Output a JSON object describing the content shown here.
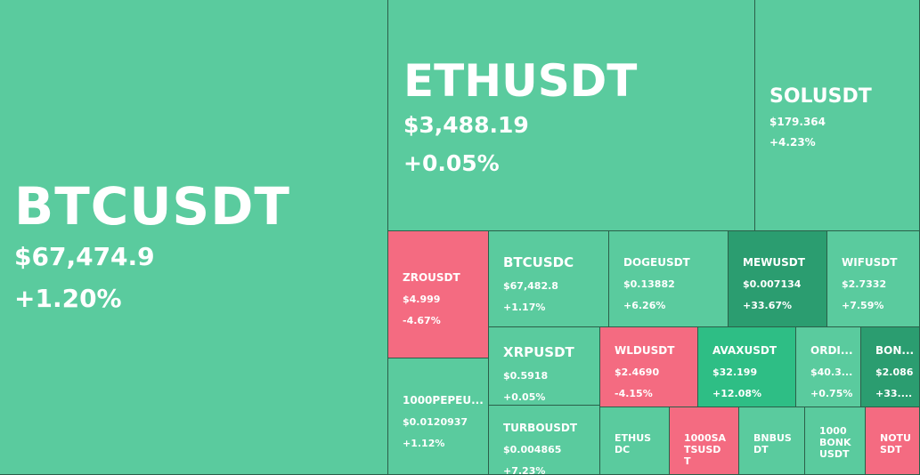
{
  "heatmap": {
    "tiles": {
      "btcusdt": {
        "symbol": "BTCUSDT",
        "price": "$67,474.9",
        "change": "+1.20%"
      },
      "ethusdt": {
        "symbol": "ETHUSDT",
        "price": "$3,488.19",
        "change": "+0.05%"
      },
      "solusdt": {
        "symbol": "SOLUSDT",
        "price": "$179.364",
        "change": "+4.23%"
      },
      "zrousdt": {
        "symbol": "ZROUSDT",
        "price": "$4.999",
        "change": "-4.67%"
      },
      "btcusdc": {
        "symbol": "BTCUSDC",
        "price": "$67,482.8",
        "change": "+1.17%"
      },
      "dogeusdt": {
        "symbol": "DOGEUSDT",
        "price": "$0.13882",
        "change": "+6.26%"
      },
      "mewusdt": {
        "symbol": "MEWUSDT",
        "price": "$0.007134",
        "change": "+33.67%"
      },
      "wifusdt": {
        "symbol": "WIFUSDT",
        "price": "$2.7332",
        "change": "+7.59%"
      },
      "pepeusdt": {
        "symbol": "1000PEPEU...",
        "price": "$0.0120937",
        "change": "+1.12%"
      },
      "xrpusdt": {
        "symbol": "XRPUSDT",
        "price": "$0.5918",
        "change": "+0.05%"
      },
      "wldusdt": {
        "symbol": "WLDUSDT",
        "price": "$2.4690",
        "change": "-4.15%"
      },
      "avaxusdt": {
        "symbol": "AVAXUSDT",
        "price": "$32.199",
        "change": "+12.08%"
      },
      "ordiusdt": {
        "symbol": "ORDI...",
        "price": "$40.3...",
        "change": "+0.75%"
      },
      "bonkusdt": {
        "symbol": "BON...",
        "price": "$2.086",
        "change": "+33...."
      },
      "turbousdt": {
        "symbol": "TURBOUSDT",
        "price": "$0.004865",
        "change": "+7.23%"
      },
      "ethusdc": {
        "symbol": "ETHUSDC"
      },
      "satsusdt": {
        "symbol": "1000SATSUSDT"
      },
      "bnbusdt": {
        "symbol": "BNBUSDT"
      },
      "bonk1000usdt": {
        "symbol": "1000BONKUSDT"
      },
      "notusdt": {
        "symbol": "NOTUSDT"
      }
    }
  },
  "colors": {
    "up": "#5acb9e",
    "down": "#f46b81",
    "strong_up": "#2b9d70",
    "mid_up": "#2ebe85",
    "border": "#2b5f49",
    "text": "#ffffff"
  }
}
